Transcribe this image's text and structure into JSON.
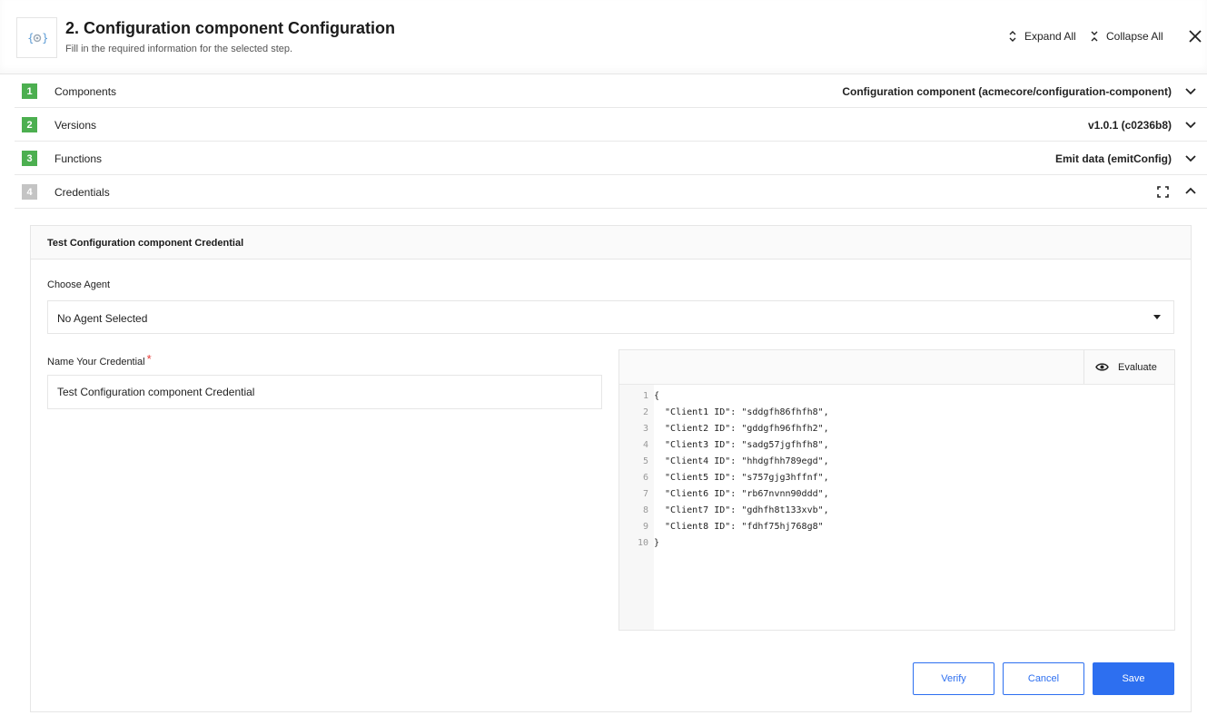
{
  "header": {
    "logo_icon": "config-component-icon",
    "title": "2. Configuration component Configuration",
    "subtitle": "Fill in the required information for the selected step.",
    "expand_all": "Expand All",
    "collapse_all": "Collapse All",
    "close_icon": "close-icon"
  },
  "steps": [
    {
      "number": "1",
      "label": "Components",
      "value": "Configuration component (acmecore/configuration-component)",
      "status": "done",
      "expanded": false
    },
    {
      "number": "2",
      "label": "Versions",
      "value": "v1.0.1 (c0236b8)",
      "status": "done",
      "expanded": false
    },
    {
      "number": "3",
      "label": "Functions",
      "value": "Emit data (emitConfig)",
      "status": "done",
      "expanded": false
    },
    {
      "number": "4",
      "label": "Credentials",
      "value": "",
      "status": "pending",
      "expanded": true
    }
  ],
  "colors": {
    "step_done": "#4caf50",
    "step_pending": "#c4c4c4",
    "primary": "#2d6ff0",
    "required": "#e53935"
  },
  "credential": {
    "card_title": "Test Configuration component Credential",
    "agent_label": "Choose Agent",
    "agent_value": "No Agent Selected",
    "name_label": "Name Your Credential",
    "required_mark": "*",
    "name_value": "Test Configuration component Credential",
    "evaluate_label": "Evaluate",
    "code_lines": [
      {
        "n": "1",
        "text": "{"
      },
      {
        "n": "2",
        "text": "  \"Client1 ID\": \"sddgfh86fhfh8\","
      },
      {
        "n": "3",
        "text": "  \"Client2 ID\": \"gddgfh96fhfh2\","
      },
      {
        "n": "4",
        "text": "  \"Client3 ID\": \"sadg57jgfhfh8\","
      },
      {
        "n": "5",
        "text": "  \"Client4 ID\": \"hhdgfhh789egd\","
      },
      {
        "n": "6",
        "text": "  \"Client5 ID\": \"s757gjg3hffnf\","
      },
      {
        "n": "7",
        "text": "  \"Client6 ID\": \"rb67nvnn90ddd\","
      },
      {
        "n": "8",
        "text": "  \"Client7 ID\": \"gdhfh8t133xvb\","
      },
      {
        "n": "9",
        "text": "  \"Client8 ID\": \"fdhf75hj768g8\""
      },
      {
        "n": "10",
        "text": "}"
      }
    ],
    "buttons": {
      "verify": "Verify",
      "cancel": "Cancel",
      "save": "Save"
    }
  }
}
